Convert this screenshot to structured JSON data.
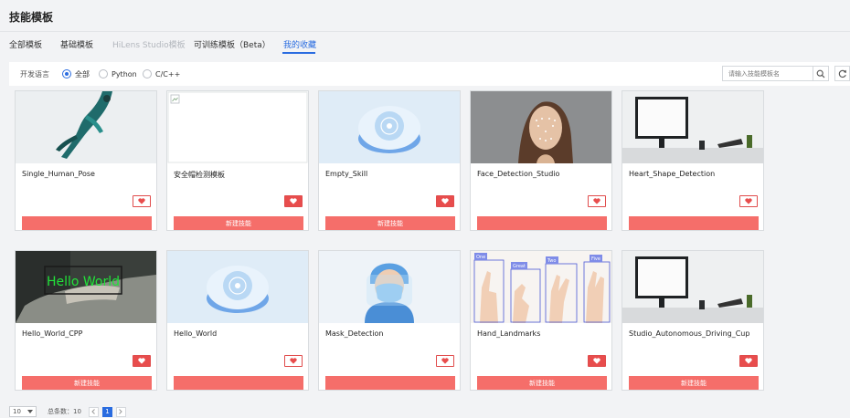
{
  "page_title": "技能模板",
  "tabs": [
    {
      "label": "全部模板"
    },
    {
      "label": "基础模板"
    },
    {
      "label": "HiLens Studio模板"
    },
    {
      "label": "可训练模板（Beta）"
    },
    {
      "label": "我的收藏"
    }
  ],
  "filter": {
    "label": "开发语言",
    "options": [
      {
        "label": "全部",
        "selected": true
      },
      {
        "label": "Python",
        "selected": false
      },
      {
        "label": "C/C++",
        "selected": false
      }
    ],
    "search_placeholder": "请输入技能模板名"
  },
  "cards": [
    {
      "name": "Single_Human_Pose",
      "button": "",
      "heart": "outline"
    },
    {
      "name": "安全帽检测模板",
      "button": "新建技能",
      "heart": "filled"
    },
    {
      "name": "Empty_Skill",
      "button": "新建技能",
      "heart": "filled"
    },
    {
      "name": "Face_Detection_Studio",
      "button": "",
      "heart": "outline"
    },
    {
      "name": "Heart_Shape_Detection",
      "button": "",
      "heart": "outline"
    },
    {
      "name": "Hello_World_CPP",
      "button": "新建技能",
      "heart": "filled",
      "thumb_text": "Hello World"
    },
    {
      "name": "Hello_World",
      "button": "",
      "heart": "outline"
    },
    {
      "name": "Mask_Detection",
      "button": "",
      "heart": "outline"
    },
    {
      "name": "Hand_Landmarks",
      "button": "新建技能",
      "heart": "filled",
      "thumb_tags": [
        "One",
        "Great",
        "Two",
        "Five"
      ]
    },
    {
      "name": "Studio_Autonomous_Driving_Cup",
      "button": "新建技能",
      "heart": "filled"
    }
  ],
  "pagination": {
    "page_size": "10",
    "total_text": "总条数：10",
    "current_page": "1"
  },
  "colors": {
    "accent": "#2a6ce0",
    "button": "#f56e6a",
    "heart": "#e84d4d"
  }
}
